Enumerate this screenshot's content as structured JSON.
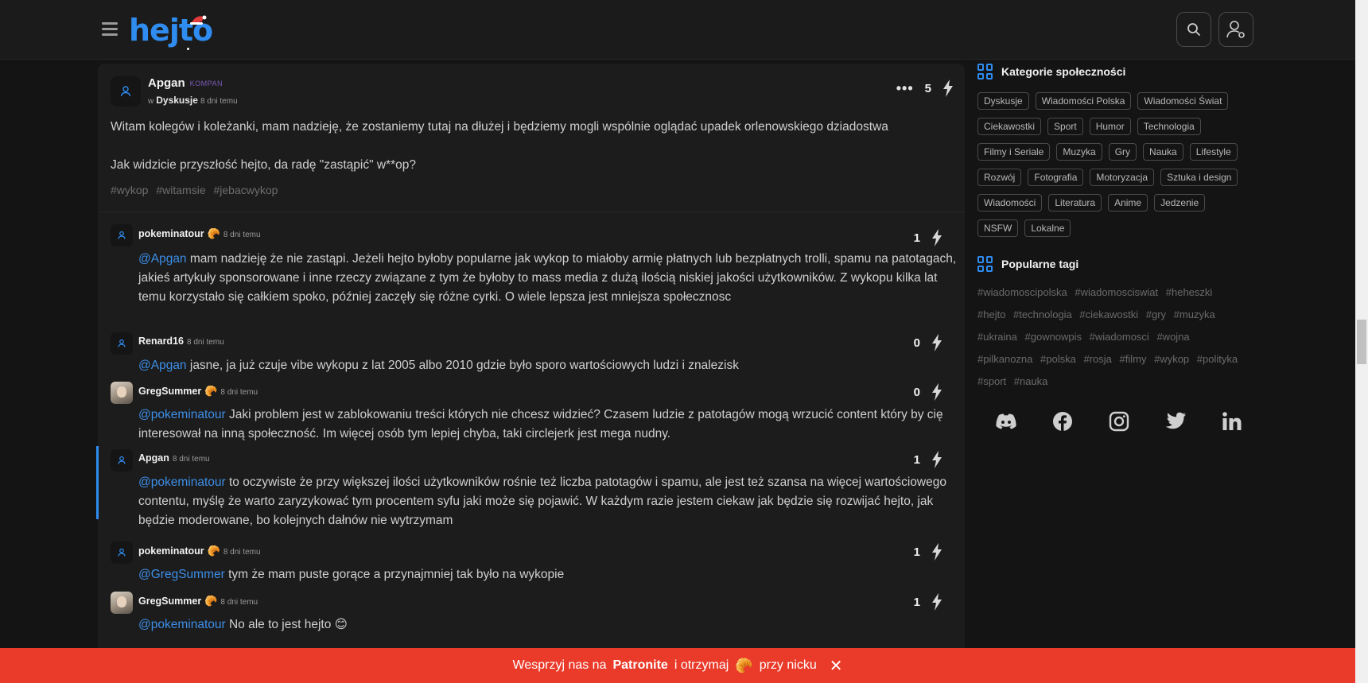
{
  "header": {
    "logo": "hejto"
  },
  "post": {
    "author": "Apgan",
    "badge": "KOMPAN",
    "in_label": "w",
    "category": "Dyskusje",
    "time": "8 dni temu",
    "menu": "•••",
    "votes": "5",
    "paragraphs": [
      "Witam kolegów i koleżanki, mam nadzieję, że zostaniemy tutaj na dłużej i będziemy mogli wspólnie oglądać upadek orlenowskiego dziadostwa",
      "Jak widzicie przyszłość hejto, da radę \"zastąpić\" w**op?"
    ],
    "tags": [
      "#wykop",
      "#witamsie",
      "#jebacwykop"
    ]
  },
  "comments": [
    {
      "author": "pokeminatour",
      "badge": "🥐",
      "time": "8 dni temu",
      "votes": "1",
      "mention": "@Apgan",
      "text": " mam nadzieję że nie zastąpi. Jeżeli hejto byłoby popularne jak wykop to miałoby armię płatnych lub bezpłatnych trolli, spamu na patotagach, jakieś artykuły sponsorowane i inne rzeczy związane z tym że byłoby to mass media z dużą ilością niskiej jakości użytkowników. Z wykopu kilka lat temu korzystało się całkiem spoko, później zaczęły się różne cyrki. O wiele lepsza jest mniejsza społecznosc"
    },
    {
      "author": "Renard16",
      "badge": "",
      "time": "8 dni temu",
      "votes": "0",
      "mention": "@Apgan",
      "text": " jasne, ja już czuje vibe wykopu z lat 2005 albo 2010 gdzie było sporo wartościowych ludzi i znalezisk"
    },
    {
      "author": "GregSummer",
      "badge": "🥐",
      "time": "8 dni temu",
      "votes": "0",
      "mention": "@pokeminatour",
      "text": " Jaki problem jest w zablokowaniu treści których nie chcesz widzieć? Czasem ludzie z patotagów mogą wrzucić content który by cię interesował na inną społeczność. Im więcej osób tym lepiej chyba, taki circlejerk jest mega nudny."
    },
    {
      "author": "Apgan",
      "badge": "",
      "time": "8 dni temu",
      "votes": "1",
      "mention": "@pokeminatour",
      "text": " to oczywiste że przy większej ilości użytkowników rośnie też liczba patotagów i spamu, ale jest też szansa na więcej wartościowego contentu, myślę że warto zaryzykować tym procentem syfu jaki może się pojawić. W każdym razie jestem ciekaw jak będzie się rozwijać hejto, jak będzie moderowane, bo kolejnych dałnów nie wytrzymam"
    },
    {
      "author": "pokeminatour",
      "badge": "🥐",
      "time": "8 dni temu",
      "votes": "1",
      "mention": "@GregSummer",
      "text": " tym że mam puste gorące a przynajmniej tak było na wykopie"
    },
    {
      "author": "GregSummer",
      "badge": "🥐",
      "time": "8 dni temu",
      "votes": "1",
      "mention": "@pokeminatour",
      "text": " No ale to jest hejto 😊"
    }
  ],
  "sidebar": {
    "categories_title": "Kategorie społeczności",
    "categories": [
      "Dyskusje",
      "Wiadomości Polska",
      "Wiadomości Świat",
      "Ciekawostki",
      "Sport",
      "Humor",
      "Technologia",
      "Filmy i Seriale",
      "Muzyka",
      "Gry",
      "Nauka",
      "Lifestyle",
      "Rozwój",
      "Fotografia",
      "Motoryzacja",
      "Sztuka i design",
      "Wiadomości",
      "Literatura",
      "Anime",
      "Jedzenie",
      "NSFW",
      "Lokalne"
    ],
    "tags_title": "Popularne tagi",
    "tags": [
      "#wiadomoscipolska",
      "#wiadomosciswiat",
      "#heheszki",
      "#hejto",
      "#technologia",
      "#ciekawostki",
      "#gry",
      "#muzyka",
      "#ukraina",
      "#gownowpis",
      "#wiadomosci",
      "#wojna",
      "#pilkanozna",
      "#polska",
      "#rosja",
      "#filmy",
      "#wykop",
      "#polityka",
      "#sport",
      "#nauka"
    ],
    "socials": [
      "discord-icon",
      "facebook-icon",
      "instagram-icon",
      "twitter-icon",
      "linkedin-icon"
    ]
  },
  "banner": {
    "pre": "Wesprzyj nas na",
    "brand": "Patronite",
    "mid": "i otrzymaj",
    "emoji": "🥐",
    "post": "przy nicku",
    "close": "✕"
  },
  "colors": {
    "accent": "#2f8cf0",
    "banner": "#ea3a2a",
    "background": "#141414"
  }
}
